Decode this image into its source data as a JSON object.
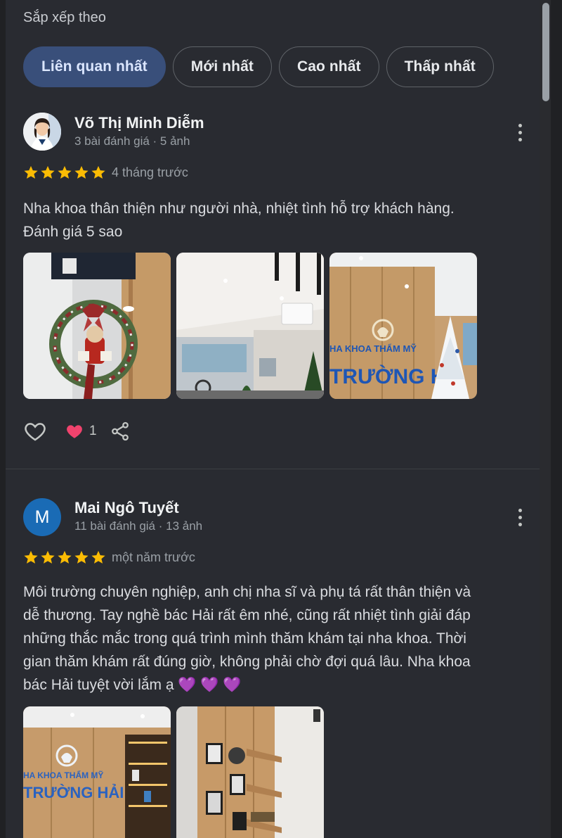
{
  "sort": {
    "title": "Sắp xếp theo",
    "chips": [
      "Liên quan nhất",
      "Mới nhất",
      "Cao nhất",
      "Thấp nhất"
    ],
    "active": 0
  },
  "reviews": [
    {
      "name": "Võ Thị Minh Diễm",
      "meta": "3 bài đánh giá · 5 ảnh",
      "rating": 5,
      "time": "4 tháng trước",
      "text_lines": [
        "Nha khoa thân thiện như người nhà, nhiệt tình hỗ trợ khách hàng.",
        "Đánh giá 5 sao"
      ],
      "likes": "1",
      "photo_signs": [
        {
          "line1": "HA KHOA THẨM MỸ",
          "line2": "TRƯỜNG HẢ"
        }
      ]
    },
    {
      "name": "Mai Ngô Tuyết",
      "avatar_letter": "M",
      "meta": "11 bài đánh giá · 13 ảnh",
      "rating": 5,
      "time": "một năm trước",
      "text_lines": [
        "Môi trường chuyên nghiệp, anh chị nha sĩ và phụ tá rất thân thiện và",
        "dễ thương. Tay nghề bác Hải rất êm nhé, cũng rất nhiệt tình giải đáp",
        "những thắc mắc trong quá trình mình thăm khám tại nha khoa. Thời",
        "gian thăm khám rất đúng giờ, không phải chờ đợi quá lâu. Nha khoa",
        "bác Hải tuyệt vời lắm ạ 💜 💜 💜"
      ],
      "photo_signs": [
        {
          "line1": "HA KHOA THẨM MỸ",
          "line2": "TRƯỜNG HẢI"
        }
      ]
    }
  ],
  "colors": {
    "star": "#fbbc04",
    "active_chip": "#394f7a",
    "heart_reaction": "#f0436d"
  }
}
